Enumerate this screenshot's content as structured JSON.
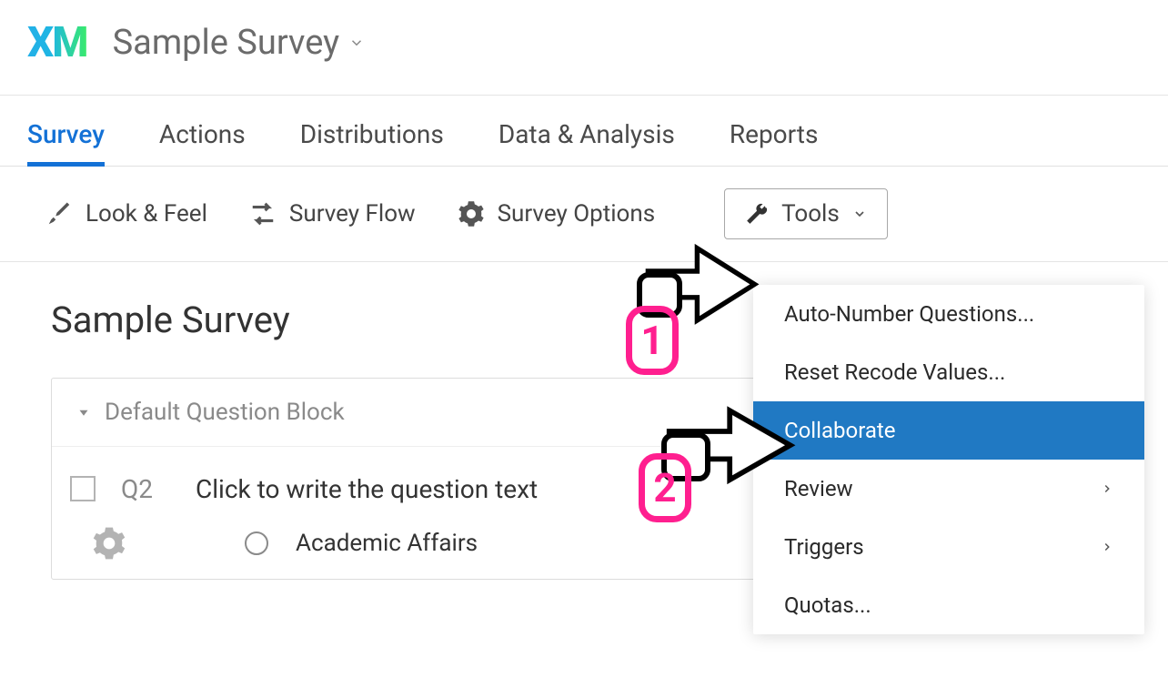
{
  "header": {
    "logo": "XM",
    "project_name": "Sample Survey"
  },
  "tabs": [
    {
      "label": "Survey",
      "active": true
    },
    {
      "label": "Actions",
      "active": false
    },
    {
      "label": "Distributions",
      "active": false
    },
    {
      "label": "Data & Analysis",
      "active": false
    },
    {
      "label": "Reports",
      "active": false
    }
  ],
  "toolbar": {
    "look_feel": "Look & Feel",
    "survey_flow": "Survey Flow",
    "survey_options": "Survey Options",
    "tools": "Tools"
  },
  "tools_menu": [
    {
      "label": "Auto-Number Questions...",
      "submenu": false,
      "selected": false
    },
    {
      "label": "Reset Recode Values...",
      "submenu": false,
      "selected": false
    },
    {
      "label": "Collaborate",
      "submenu": false,
      "selected": true
    },
    {
      "label": "Review",
      "submenu": true,
      "selected": false
    },
    {
      "label": "Triggers",
      "submenu": true,
      "selected": false
    },
    {
      "label": "Quotas...",
      "submenu": false,
      "selected": false
    }
  ],
  "content": {
    "survey_title": "Sample Survey",
    "block_name": "Default Question Block",
    "question": {
      "number": "Q2",
      "prompt": "Click to write the question text",
      "choice": "Academic Affairs"
    }
  },
  "annotations": {
    "badge1": "1",
    "badge2": "2"
  }
}
